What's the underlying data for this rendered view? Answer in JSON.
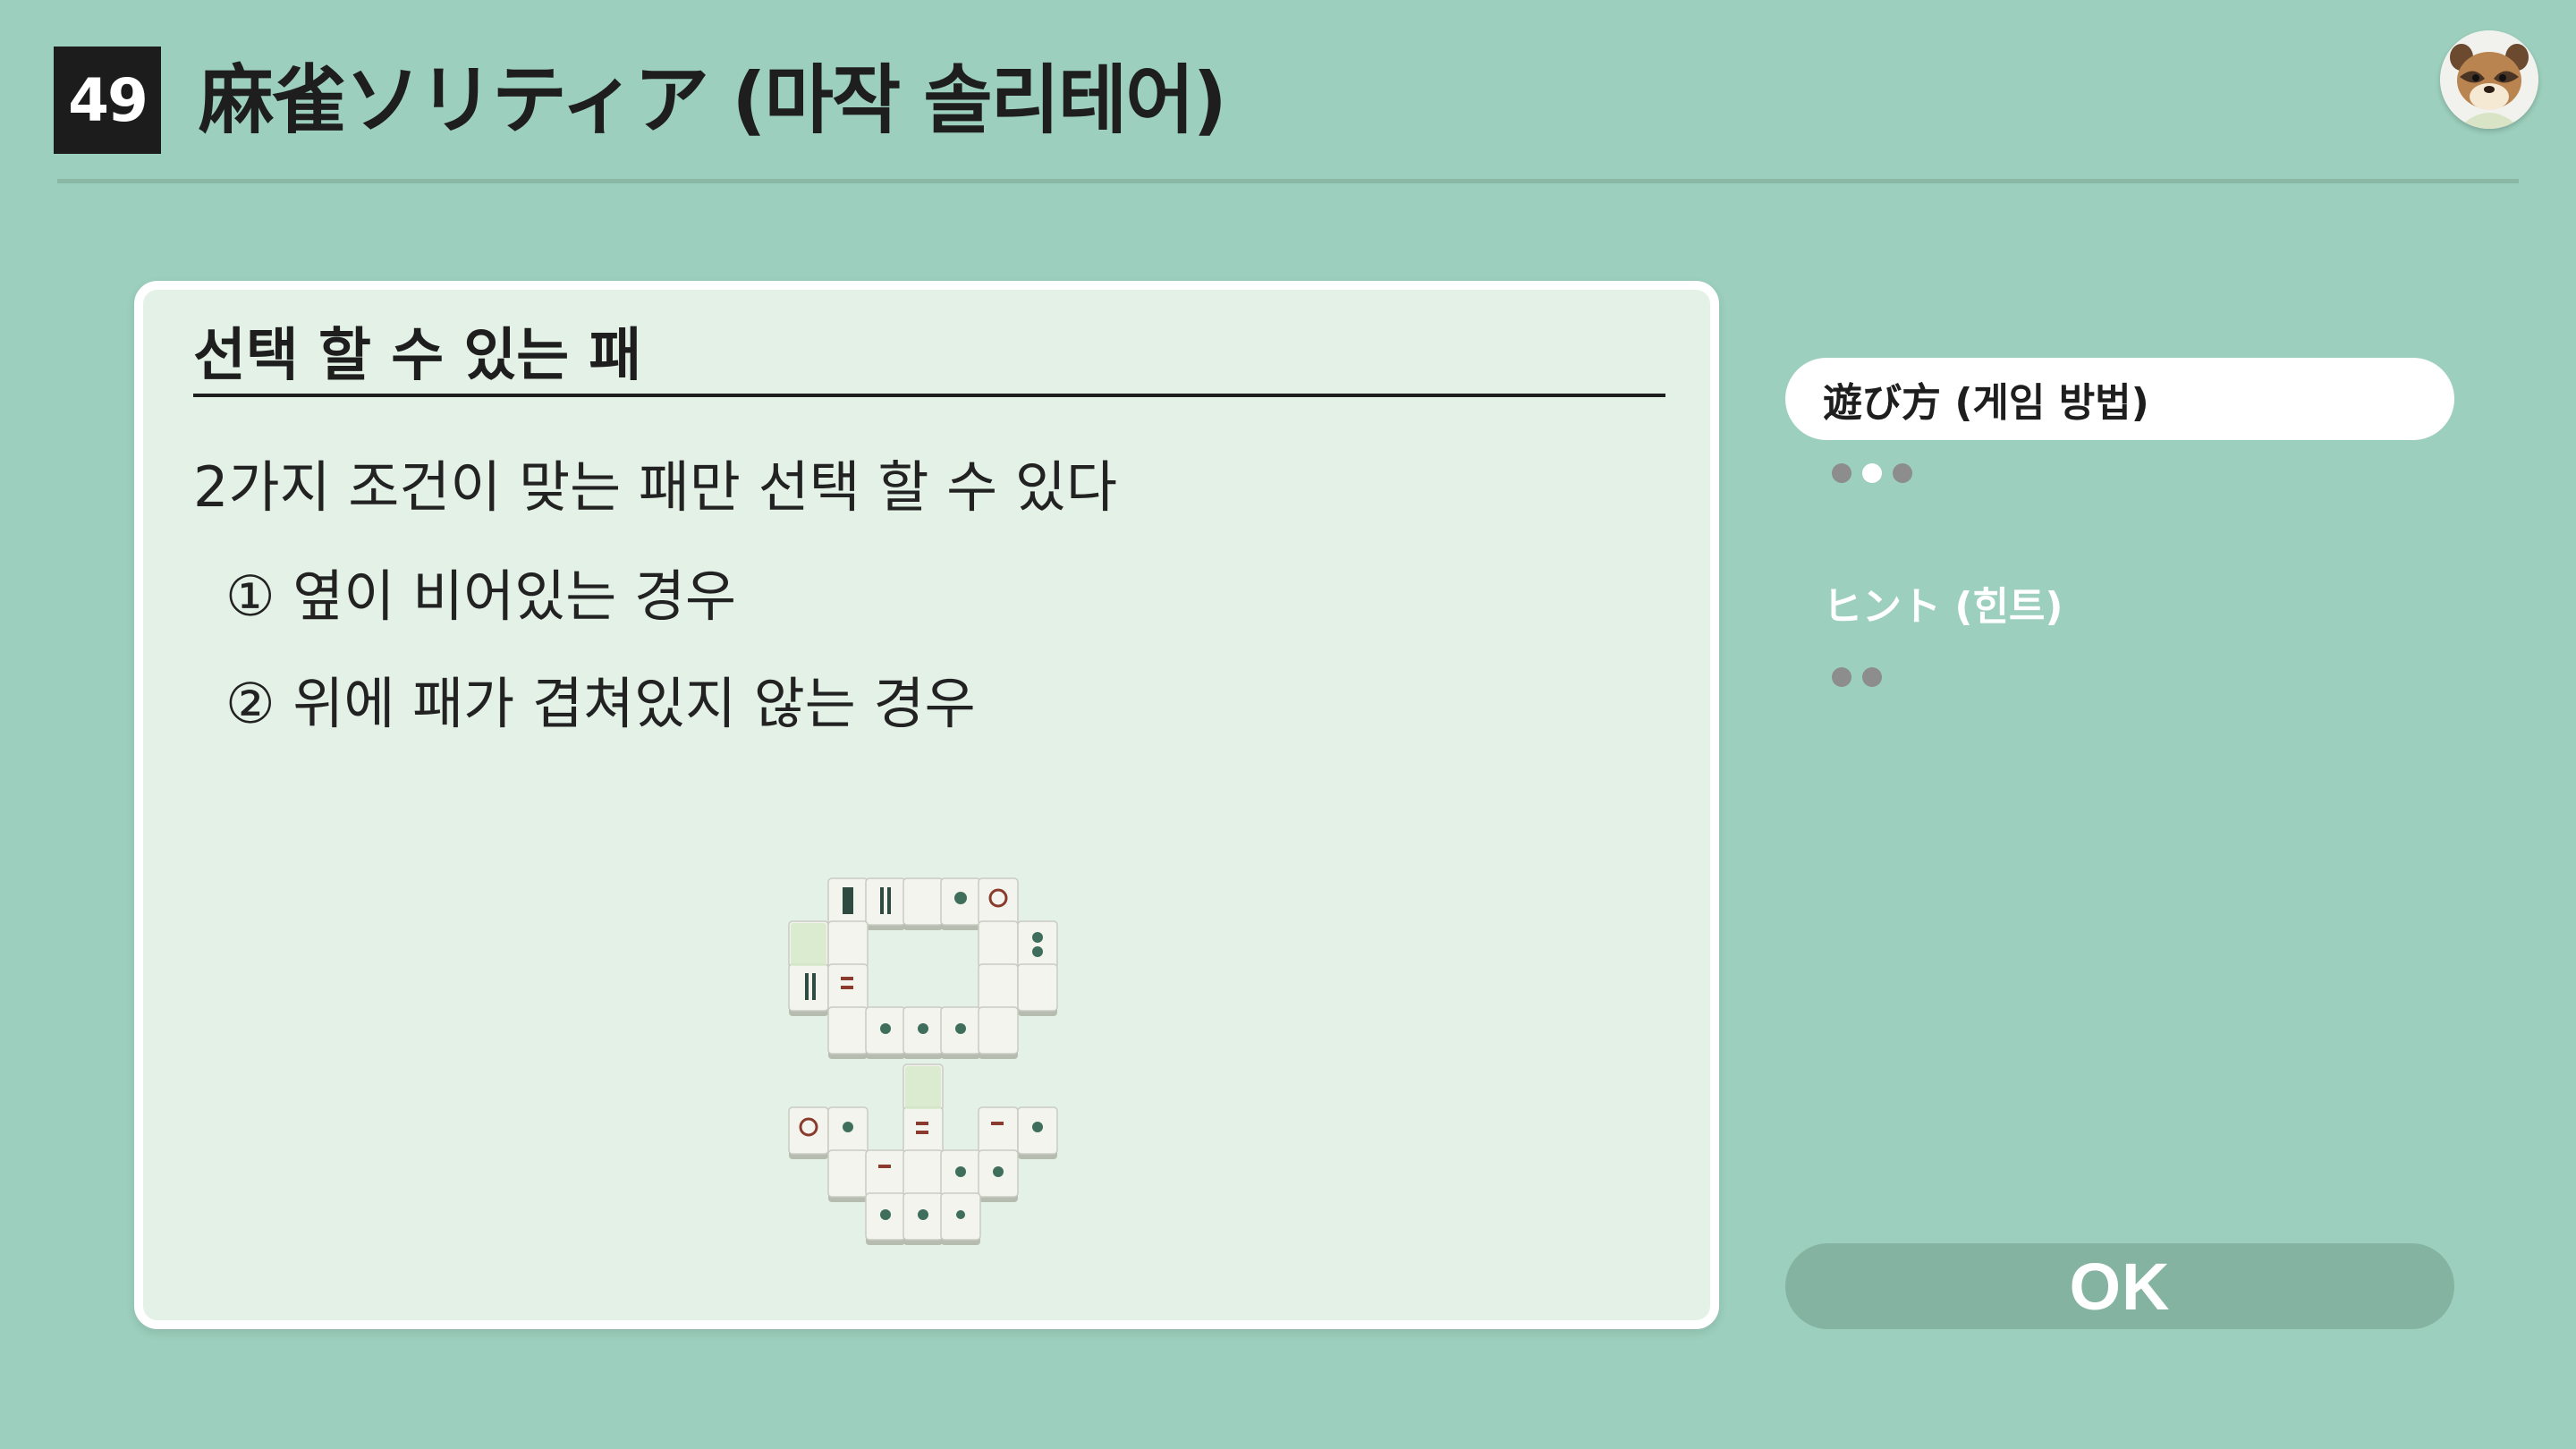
{
  "header": {
    "game_number": "49",
    "title": "麻雀ソリティア (마작 솔리테어)"
  },
  "card": {
    "heading": "선택 할 수 있는 패",
    "intro": "2가지 조건이 맞는 패만 선택 할 수 있다",
    "conditions": [
      "① 옆이 비어있는 경우",
      "② 위에 패가 겹쳐있지 않는 경우"
    ]
  },
  "menu": {
    "items": [
      {
        "label": "遊び方 (게임 방법)",
        "selected": true,
        "pages": 3,
        "current_page": 2
      },
      {
        "label": "ヒント (힌트)",
        "selected": false,
        "pages": 2
      }
    ]
  },
  "ok_button": {
    "label": "OK"
  },
  "colors": {
    "background": "#9ccfbd",
    "card": "#e3f1e6",
    "ok_button": "#84b3a2",
    "dot": "#8d8d8d"
  },
  "icons": {
    "avatar": "raccoon-avatar-icon"
  }
}
